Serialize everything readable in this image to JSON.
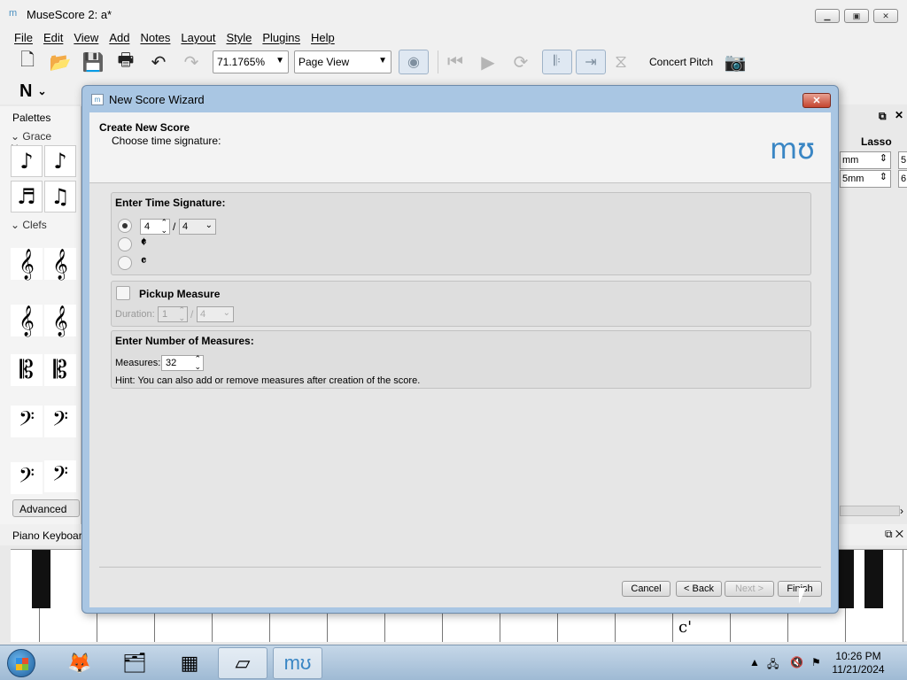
{
  "app": {
    "title": "MuseScore 2: a*"
  },
  "menu": [
    "File",
    "Edit",
    "View",
    "Add",
    "Notes",
    "Layout",
    "Style",
    "Plugins",
    "Help"
  ],
  "toolbar": {
    "zoom": "71.1765%",
    "view_mode": "Page View",
    "concert_pitch": "Concert Pitch"
  },
  "palettes": {
    "title": "Palettes",
    "sections": [
      "Grace Notes",
      "Clefs"
    ],
    "advanced": "Advanced"
  },
  "inspector": {
    "lasso": "Lasso",
    "val1": "mm",
    "val2": "5mm",
    "val1b": "5",
    "val2b": "6"
  },
  "piano": {
    "title": "Piano Keyboard",
    "c_label": "c'"
  },
  "dialog": {
    "title": "New Score Wizard",
    "header_title": "Create New Score",
    "header_sub": "Choose time signature:",
    "time_sig": {
      "title": "Enter Time Signature:",
      "numerator": "4",
      "denominator": "4",
      "slash": "/",
      "common_time": "𝄴",
      "cut_time": "𝄵"
    },
    "pickup": {
      "title": "Pickup Measure",
      "duration_label": "Duration:",
      "numerator": "1",
      "denominator": "4",
      "slash": "/"
    },
    "measures": {
      "title": "Enter Number of Measures:",
      "label": "Measures:",
      "value": "32",
      "hint": "Hint: You can also add or remove measures after creation of the score."
    },
    "buttons": {
      "cancel": "Cancel",
      "back": "< Back",
      "next": "Next >",
      "finish": "Finish"
    }
  },
  "taskbar": {
    "time": "10:26 PM",
    "date": "11/21/2024"
  },
  "colors": {
    "dialog_frame": "#a9c6e3",
    "close_red": "#c4452f",
    "accent_blue": "#3a86c4"
  }
}
